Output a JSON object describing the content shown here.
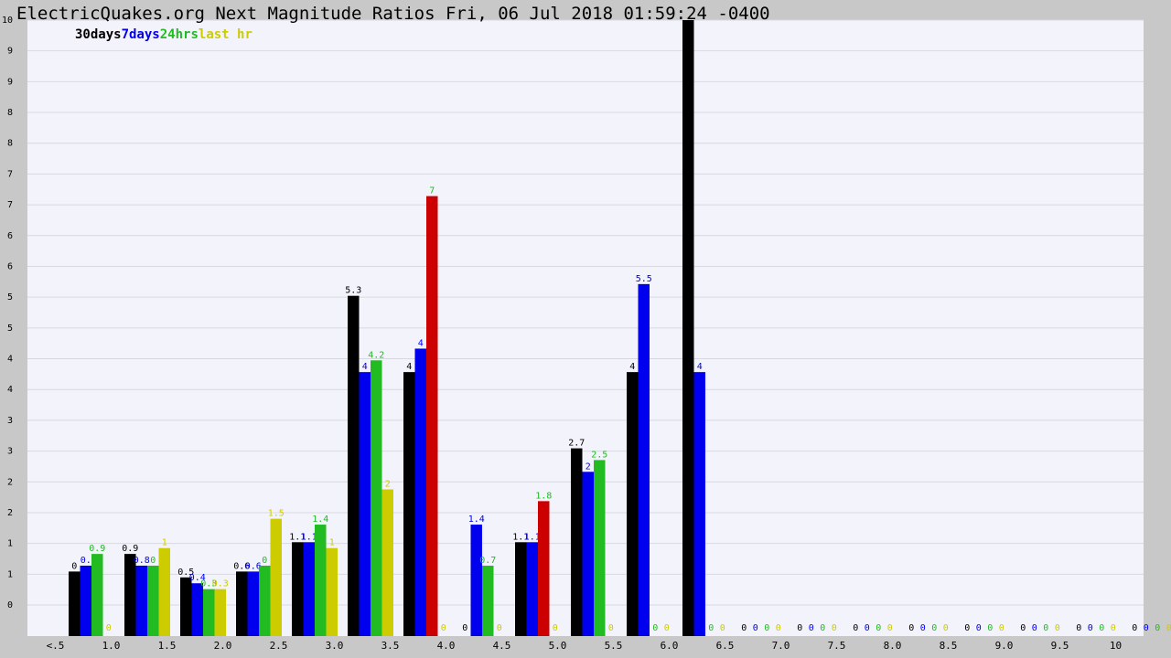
{
  "page": {
    "title": "ElectricQuakes.org Next Magnitude Ratios Fri, 06 Jul 2018 01:59:24 -0400"
  },
  "legend": {
    "items": [
      {
        "label": "30days",
        "color": "#000000"
      },
      {
        "label": "7days",
        "color": "#0000ee"
      },
      {
        "label": "24hrs",
        "color": "#22bb22"
      },
      {
        "label": "last hr",
        "color": "#cccc00"
      }
    ]
  },
  "colors": {
    "plot_background": "#f3f3fb",
    "page_background": "#c8c8c8",
    "gridline": "#d8d8e0",
    "clipped_bar": "#cc0000"
  },
  "chart_data": {
    "type": "bar",
    "title": "ElectricQuakes.org Next Magnitude Ratios Fri, 06 Jul 2018 01:59:24 -0400",
    "xlabel": "",
    "ylabel": "",
    "ylim": [
      -0.5,
      10
    ],
    "grid": true,
    "legend_position": "top-left",
    "y_tick_labels": [
      "10",
      "9",
      "9",
      "8",
      "8",
      "7",
      "7",
      "6",
      "6",
      "5",
      "5",
      "4",
      "4",
      "3",
      "3",
      "2",
      "2",
      "1",
      "1",
      "0"
    ],
    "categories": [
      "<.5",
      "1.0",
      "1.5",
      "2.0",
      "2.5",
      "3.0",
      "3.5",
      "4.0",
      "4.5",
      "5.0",
      "5.5",
      "6.0",
      "6.5",
      "7.0",
      "7.5",
      "8.0",
      "8.5",
      "9.0",
      "9.5",
      "10"
    ],
    "series": [
      {
        "name": "30days",
        "color": "#000000",
        "values": [
          0.6,
          0.9,
          0.5,
          0.6,
          1.1,
          5.3,
          4,
          0,
          1.1,
          2.7,
          4,
          10,
          0,
          0,
          0,
          0,
          0,
          0,
          0,
          0
        ],
        "labels": [
          "0",
          "0.9",
          "0.5",
          "0.6",
          "1.1",
          "5.3",
          "4",
          "0",
          "1.1",
          "2.7",
          "4",
          "",
          "0",
          "0",
          "0",
          "0",
          "0",
          "0",
          "0",
          "0"
        ]
      },
      {
        "name": "7days",
        "color": "#0000ee",
        "values": [
          0.7,
          0.7,
          0.4,
          0.6,
          1.1,
          4,
          4.4,
          1.4,
          1.1,
          2.3,
          5.5,
          4,
          0,
          0,
          0,
          0,
          0,
          0,
          0,
          0
        ],
        "labels": [
          "0.",
          "0.8",
          "0.4",
          "0.6",
          "1.1",
          "4",
          "4",
          "1.4",
          "1.1",
          "2",
          "5.5",
          "4",
          "0",
          "0",
          "0",
          "0",
          "0",
          "0",
          "0",
          "0"
        ]
      },
      {
        "name": "24hrs",
        "color": "#22bb22",
        "values": [
          0.9,
          0.7,
          0.3,
          0.7,
          1.4,
          4.2,
          7,
          0.7,
          1.8,
          2.5,
          0,
          0,
          0,
          0,
          0,
          0,
          0,
          0,
          0,
          0
        ],
        "labels": [
          "0.9",
          "0",
          "0.3",
          "0",
          "1.4",
          "4.2",
          "7",
          "0.7",
          "1.8",
          "2.5",
          "0",
          "0",
          "0",
          "0",
          "0",
          "0",
          "0",
          "0",
          "0",
          "0"
        ]
      },
      {
        "name": "last hr",
        "color": "#cccc00",
        "values": [
          0,
          1,
          0.3,
          1.5,
          1,
          2,
          0,
          0,
          0,
          0,
          0,
          0,
          0,
          0,
          0,
          0,
          0,
          0,
          0,
          0
        ],
        "labels": [
          "0",
          "1",
          "0.3",
          "1.5",
          "1",
          "2",
          "0",
          "0",
          "0",
          "0",
          "0",
          "0",
          "0",
          "0",
          "0",
          "0",
          "0",
          "0",
          "0",
          "0"
        ]
      }
    ]
  }
}
